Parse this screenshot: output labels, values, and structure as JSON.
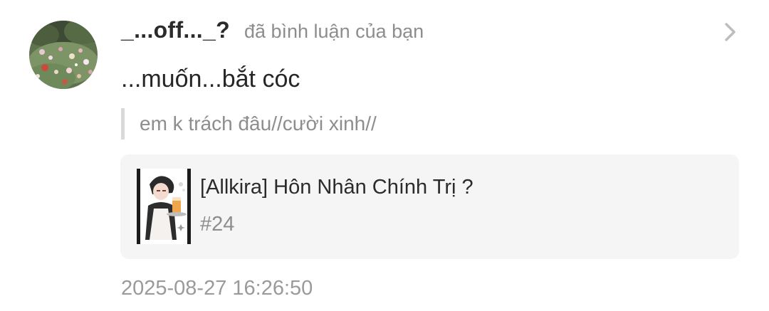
{
  "notification": {
    "username": "_...off..._?",
    "action_text": "đã bình luận của bạn",
    "comment_text": "...muốn...bắt cóc",
    "quoted_text": "em k trách đâu//cười xinh//",
    "story": {
      "title": "[Allkira] Hôn Nhân Chính Trị ?",
      "chapter": "#24"
    },
    "timestamp": "2025-08-27 16:26:50"
  },
  "icons": {
    "chevron": "chevron-right-icon",
    "avatar": "flower-garden-avatar",
    "cover": "anime-character-cover"
  },
  "colors": {
    "username": "#2b2b2b",
    "secondary_text": "#8d8d8d",
    "card_background": "#f5f5f6",
    "quote_bar": "#d9d9d9"
  }
}
